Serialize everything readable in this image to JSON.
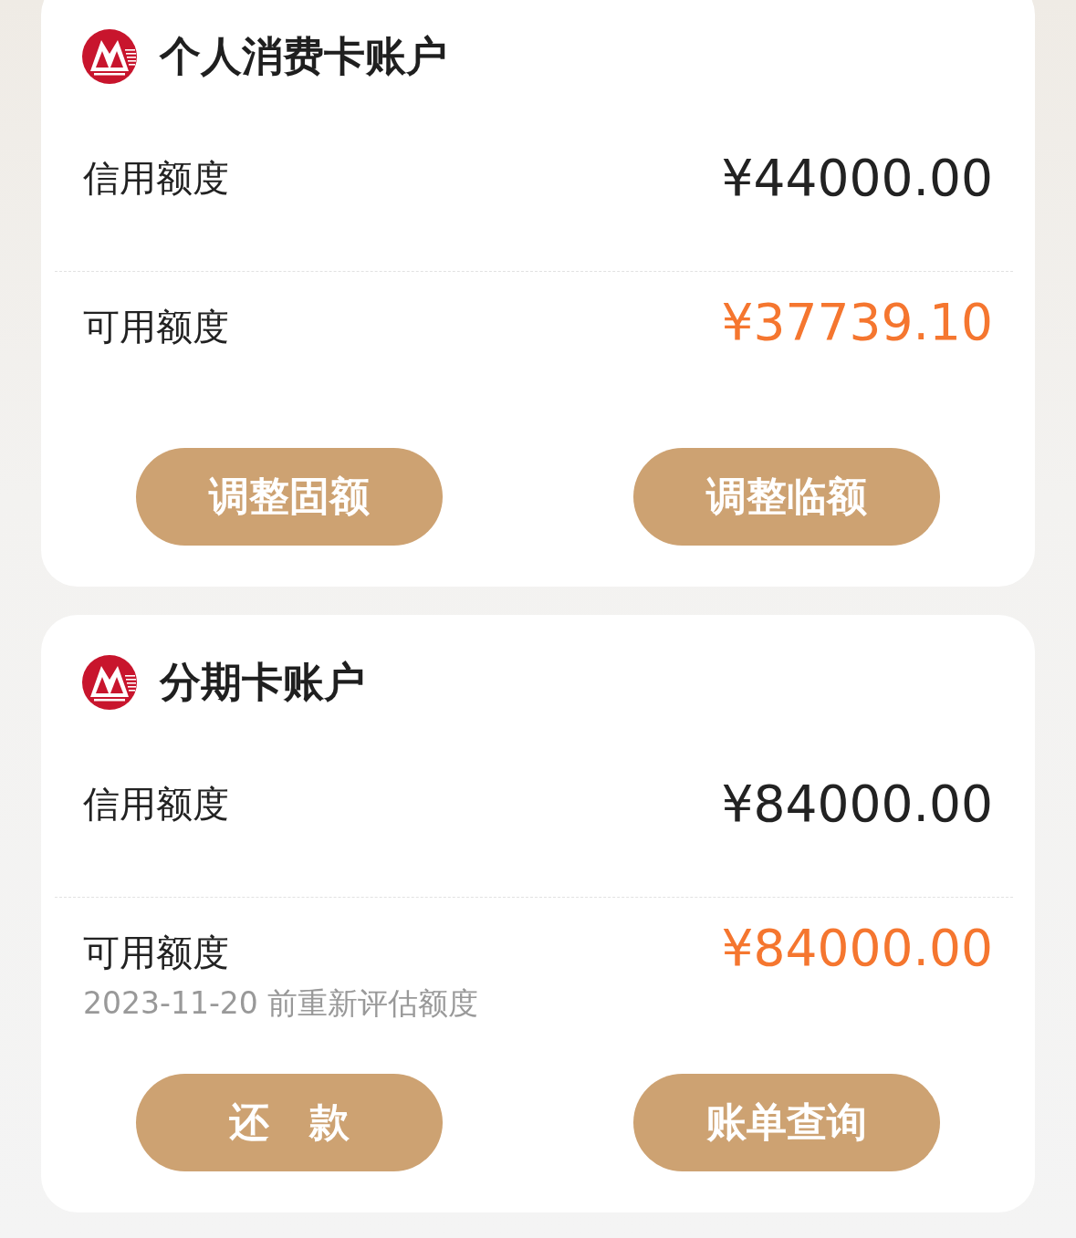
{
  "accounts": [
    {
      "title": "个人消费卡账户",
      "rows": [
        {
          "label": "信用额度",
          "amount": "¥44000.00",
          "kind": "total"
        },
        {
          "label": "可用额度",
          "amount": "¥37739.10",
          "kind": "available"
        }
      ],
      "buttons": [
        "调整固额",
        "调整临额"
      ]
    },
    {
      "title": "分期卡账户",
      "rows": [
        {
          "label": "信用额度",
          "amount": "¥84000.00",
          "kind": "total"
        },
        {
          "label": "可用额度",
          "amount": "¥84000.00",
          "kind": "available",
          "note": "2023-11-20 前重新评估额度"
        }
      ],
      "buttons": [
        "还　款",
        "账单查询"
      ]
    }
  ]
}
